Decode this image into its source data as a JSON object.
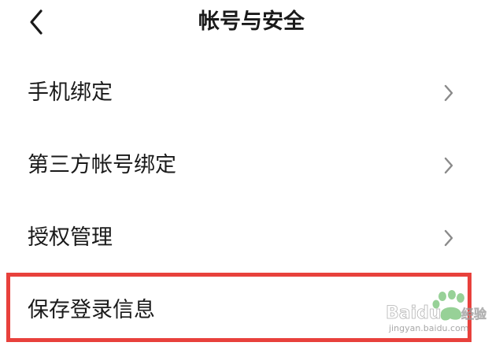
{
  "header": {
    "title": "帐号与安全",
    "back_icon": "chevron-left-icon"
  },
  "menu": {
    "items": [
      {
        "label": "手机绑定",
        "icon": "chevron-right-icon"
      },
      {
        "label": "第三方帐号绑定",
        "icon": "chevron-right-icon"
      },
      {
        "label": "授权管理",
        "icon": "chevron-right-icon"
      },
      {
        "label": "保存登录信息",
        "icon": ""
      }
    ]
  },
  "annotation": {
    "highlight_color": "#e8413c"
  },
  "watermark": {
    "brand": "Baidu",
    "suffix": "经验",
    "url": "jingyan.baidu.com"
  },
  "colors": {
    "text": "#1a1a1a",
    "chevron": "#8a8a8a",
    "background": "#ffffff"
  }
}
